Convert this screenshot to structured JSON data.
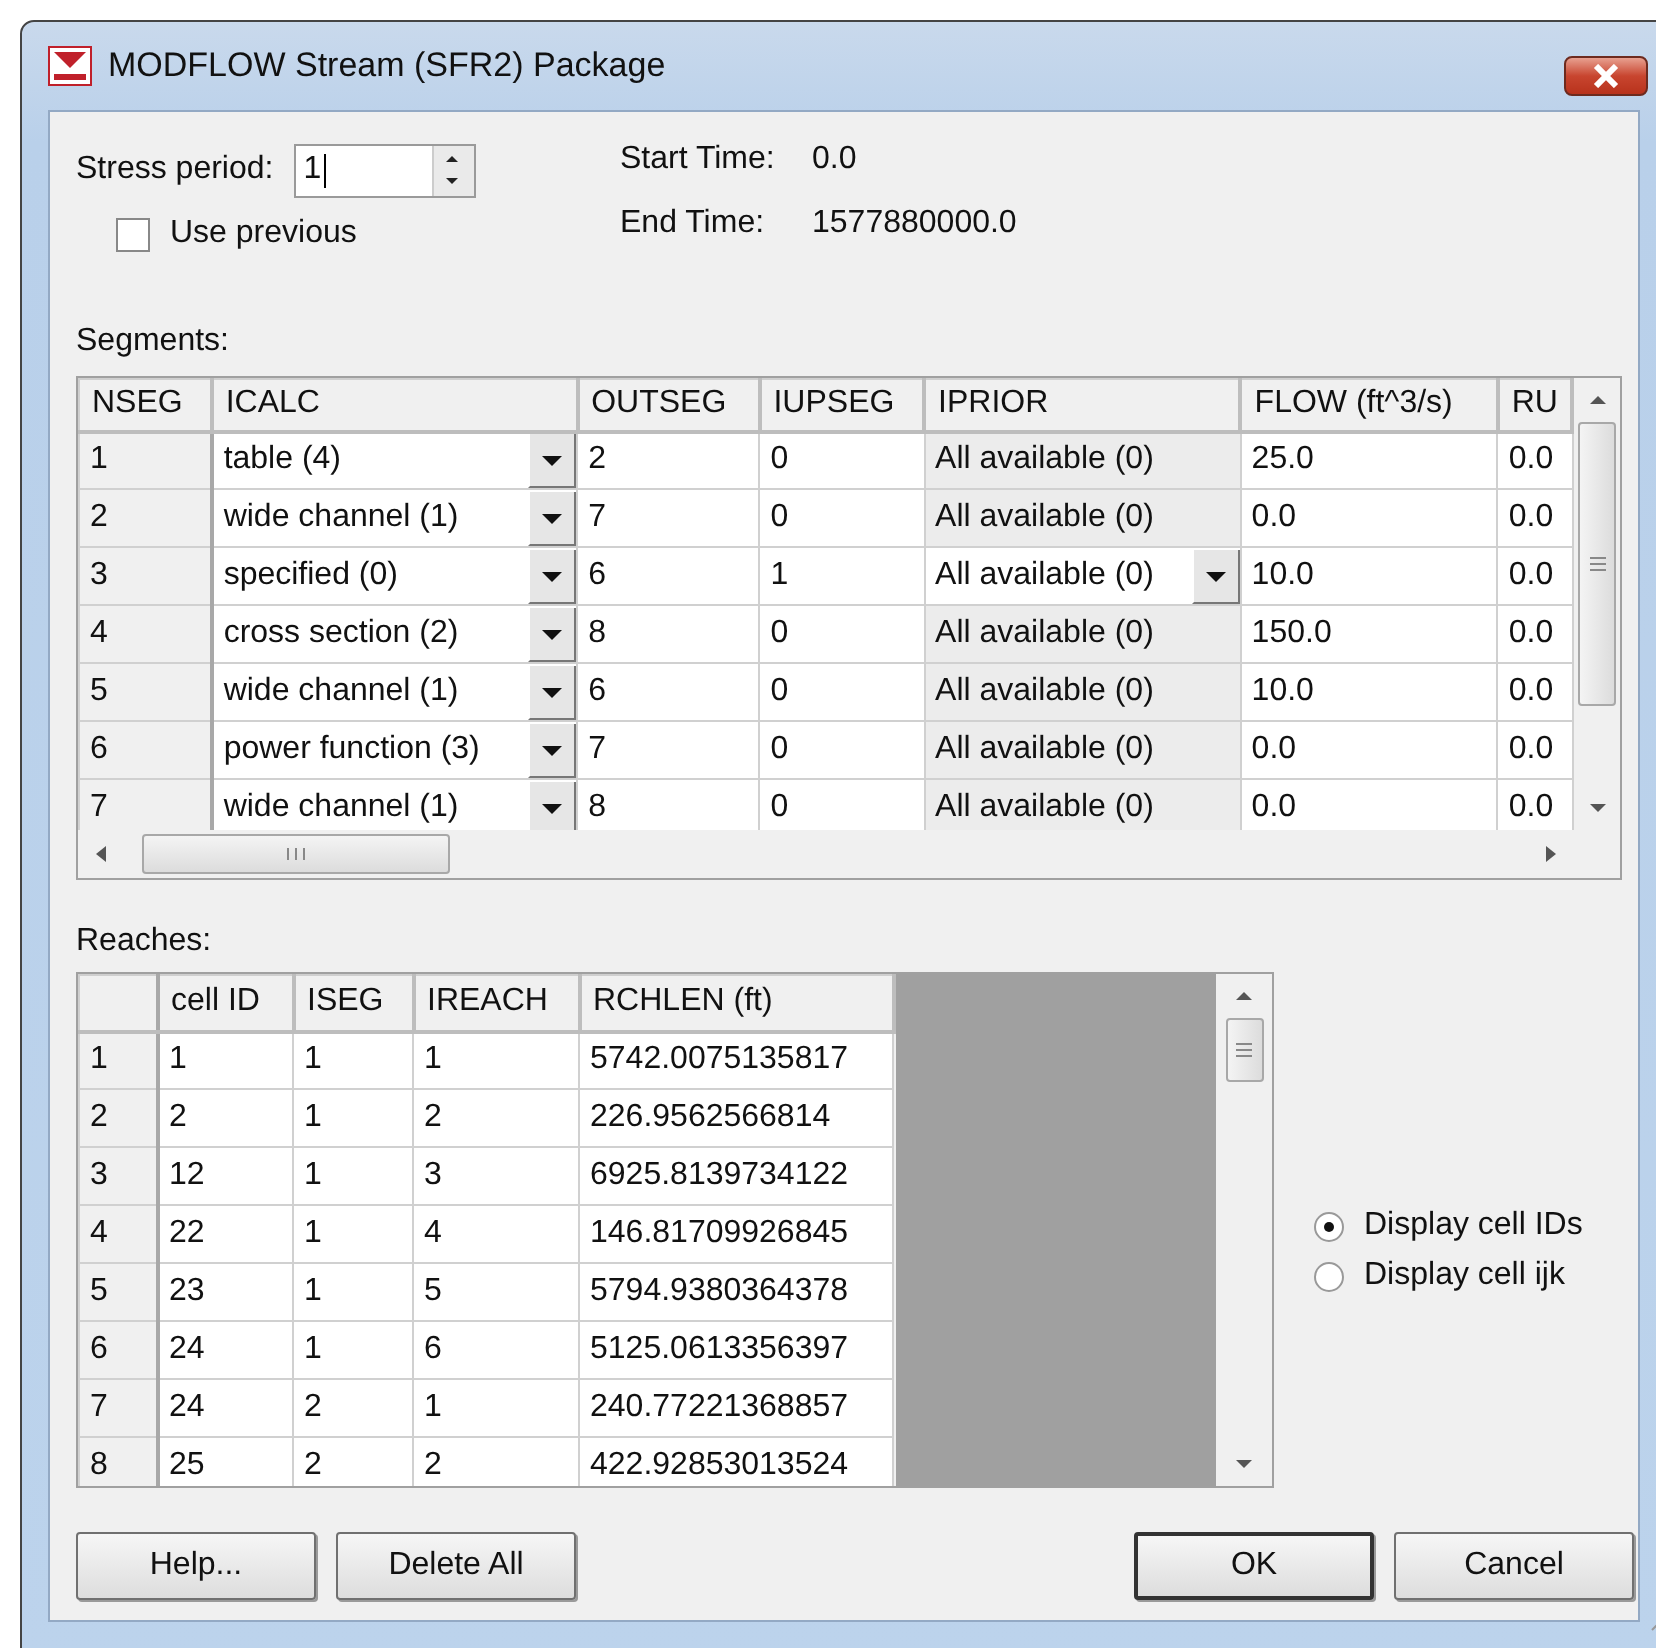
{
  "window": {
    "title": "MODFLOW Stream (SFR2) Package"
  },
  "stress_period": {
    "label": "Stress period:",
    "value": "1"
  },
  "use_previous": {
    "label": "Use previous",
    "checked": false
  },
  "start_time": {
    "label": "Start Time:",
    "value": "0.0"
  },
  "end_time": {
    "label": "End Time:",
    "value": "1577880000.0"
  },
  "segments": {
    "label": "Segments:",
    "columns": [
      "NSEG",
      "ICALC",
      "OUTSEG",
      "IUPSEG",
      "IPRIOR",
      "FLOW (ft^3/s)",
      "RU"
    ],
    "rows": [
      {
        "cells": [
          "1",
          "table (4)",
          "2",
          "0",
          "All available (0)",
          "25.0",
          "0.0"
        ],
        "selected": false
      },
      {
        "cells": [
          "2",
          "wide channel (1)",
          "7",
          "0",
          "All available (0)",
          "0.0",
          "0.0"
        ],
        "selected": false
      },
      {
        "cells": [
          "3",
          "specified (0)",
          "6",
          "1",
          "All available (0)",
          "10.0",
          "0.0"
        ],
        "selected": true
      },
      {
        "cells": [
          "4",
          "cross section (2)",
          "8",
          "0",
          "All available (0)",
          "150.0",
          "0.0"
        ],
        "selected": false
      },
      {
        "cells": [
          "5",
          "wide channel (1)",
          "6",
          "0",
          "All available (0)",
          "10.0",
          "0.0"
        ],
        "selected": false
      },
      {
        "cells": [
          "6",
          "power function (3)",
          "7",
          "0",
          "All available (0)",
          "0.0",
          "0.0"
        ],
        "selected": false
      },
      {
        "cells": [
          "7",
          "wide channel (1)",
          "8",
          "0",
          "All available (0)",
          "0.0",
          "0.0"
        ],
        "selected": false
      }
    ]
  },
  "reaches": {
    "label": "Reaches:",
    "columns": [
      "cell ID",
      "ISEG",
      "IREACH",
      "RCHLEN (ft)"
    ],
    "rows": [
      {
        "row": "1",
        "cells": [
          "1",
          "1",
          "1",
          "5742.0075135817"
        ]
      },
      {
        "row": "2",
        "cells": [
          "2",
          "1",
          "2",
          "226.9562566814"
        ]
      },
      {
        "row": "3",
        "cells": [
          "12",
          "1",
          "3",
          "6925.8139734122"
        ]
      },
      {
        "row": "4",
        "cells": [
          "22",
          "1",
          "4",
          "146.81709926845"
        ]
      },
      {
        "row": "5",
        "cells": [
          "23",
          "1",
          "5",
          "5794.9380364378"
        ]
      },
      {
        "row": "6",
        "cells": [
          "24",
          "1",
          "6",
          "5125.0613356397"
        ]
      },
      {
        "row": "7",
        "cells": [
          "24",
          "2",
          "1",
          "240.77221368857"
        ]
      },
      {
        "row": "8",
        "cells": [
          "25",
          "2",
          "2",
          "422.92853013524"
        ]
      }
    ]
  },
  "display_options": [
    {
      "label": "Display cell IDs",
      "selected": true
    },
    {
      "label": "Display cell ijk",
      "selected": false
    }
  ],
  "buttons": [
    {
      "label": "Help..."
    },
    {
      "label": "Delete All"
    },
    {
      "label": "OK"
    },
    {
      "label": "Cancel"
    }
  ]
}
